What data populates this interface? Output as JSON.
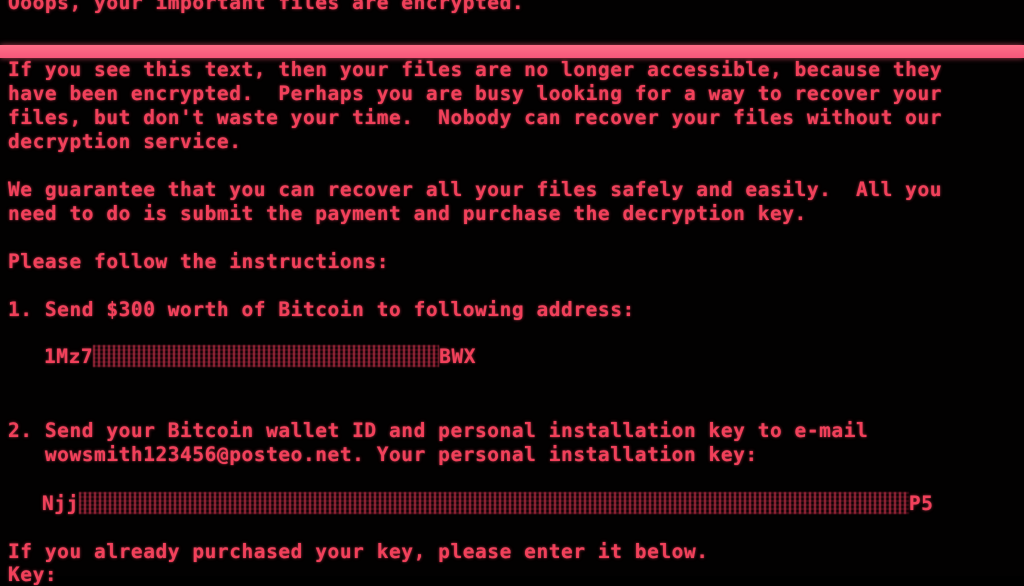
{
  "header": {
    "title": "Ooops, your important files are encrypted."
  },
  "colors": {
    "text": "#f2405a",
    "bar": "#ff6f88",
    "background": "#020101"
  },
  "body": {
    "para1": [
      "If you see this text, then your files are no longer accessible, because they",
      "have been encrypted.  Perhaps you are busy looking for a way to recover your",
      "files, but don't waste your time.  Nobody can recover your files without our",
      "decryption service."
    ],
    "para2": [
      "We guarantee that you can recover all your files safely and easily.  All you",
      "need to do is submit the payment and purchase the decryption key."
    ],
    "instructions_heading": "Please follow the instructions:",
    "step1": "1. Send $300 worth of Bitcoin to following address:",
    "bitcoin_address": {
      "prefix": "1Mz7",
      "suffix": "BWX"
    },
    "step2": [
      "2. Send your Bitcoin wallet ID and personal installation key to e-mail",
      "   wowsmith123456@posteo.net. Your personal installation key:"
    ],
    "installation_key": {
      "prefix": "Njj",
      "suffix": "P5"
    },
    "enter_key_prompt": "If you already purchased your key, please enter it below.",
    "key_label": "Key:"
  }
}
